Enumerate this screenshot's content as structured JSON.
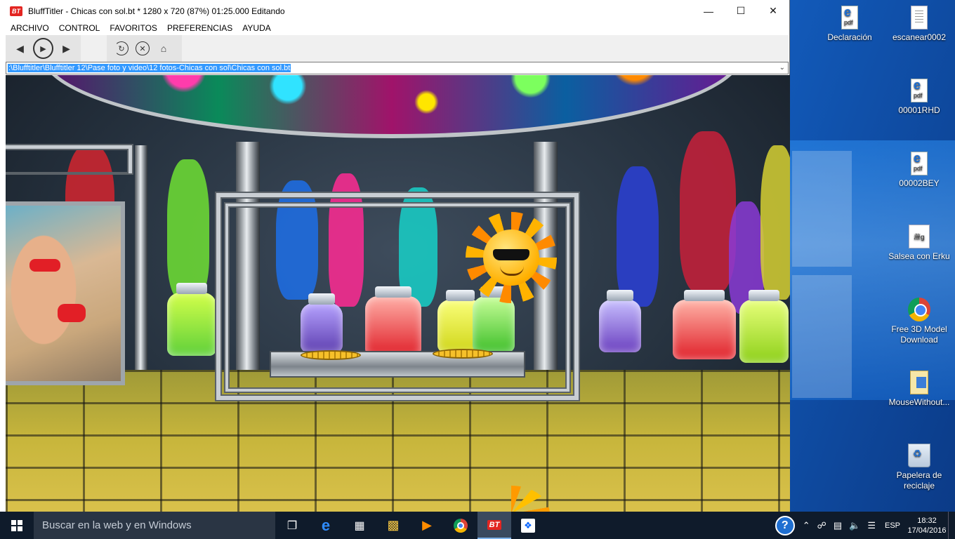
{
  "window": {
    "title": "BluffTitler - Chicas con sol.bt * 1280 x 720 (87%) 01:25.000 Editando",
    "logo_text": "BT"
  },
  "menu": [
    "ARCHIVO",
    "CONTROL",
    "FAVORITOS",
    "PREFERENCIAS",
    "AYUDA"
  ],
  "toolbar": {
    "back_icon": "back-arrow-icon",
    "play_icon": "play-icon",
    "forward_icon": "forward-arrow-icon",
    "refresh_icon": "refresh-icon",
    "stop_icon": "stop-icon",
    "home_icon": "home-icon"
  },
  "address": {
    "path": ":\\Blufftitler\\Blufftitler 12\\Pase foto y video\\12 fotos-Chicas con sol\\Chicas con sol.bt"
  },
  "desktop_icons": [
    {
      "label": "Declaración",
      "type": "pdf"
    },
    {
      "label": "escanear0002",
      "type": "doc"
    },
    {
      "label": "00001RHD",
      "type": "pdf"
    },
    {
      "label": "00002BEY",
      "type": "pdf"
    },
    {
      "label": "Salsea con Erku",
      "type": "bg"
    },
    {
      "label": "Free 3D Model Download",
      "type": "chrome"
    },
    {
      "label": "MouseWithout...",
      "type": "file"
    },
    {
      "label": "Papelera de reciclaje",
      "type": "bin"
    }
  ],
  "taskbar": {
    "search_placeholder": "Buscar en la web y en Windows",
    "language": "ESP",
    "time": "18:32",
    "date": "17/04/2016",
    "bt_label": "BT"
  },
  "colors": {
    "accent": "#1f6fd1",
    "taskbar": "#0f1b2b",
    "selection": "#3399ff",
    "bt_red": "#e32521"
  }
}
